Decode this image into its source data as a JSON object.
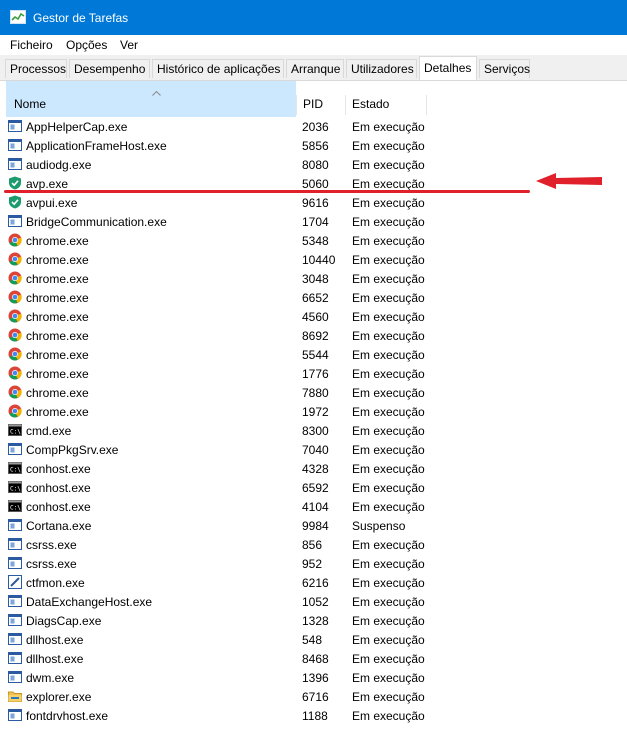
{
  "window": {
    "title": "Gestor de Tarefas"
  },
  "menu": [
    "Ficheiro",
    "Opções",
    "Ver"
  ],
  "tabs": [
    {
      "label": "Processos"
    },
    {
      "label": "Desempenho"
    },
    {
      "label": "Histórico de aplicações"
    },
    {
      "label": "Arranque"
    },
    {
      "label": "Utilizadores"
    },
    {
      "label": "Detalhes",
      "active": true
    },
    {
      "label": "Serviços"
    }
  ],
  "columns": {
    "name": "Nome",
    "pid": "PID",
    "state": "Estado"
  },
  "colors": {
    "accent": "#0078d7",
    "selected_header": "#cce8ff",
    "annotation": "#e0202a"
  },
  "rows": [
    {
      "icon": "window-icon",
      "name": "AppHelperCap.exe",
      "pid": "2036",
      "state": "Em execução"
    },
    {
      "icon": "window-icon",
      "name": "ApplicationFrameHost.exe",
      "pid": "5856",
      "state": "Em execução"
    },
    {
      "icon": "window-icon",
      "name": "audiodg.exe",
      "pid": "8080",
      "state": "Em execução"
    },
    {
      "icon": "shield-icon",
      "name": "avp.exe",
      "pid": "5060",
      "state": "Em execução"
    },
    {
      "icon": "shield-icon",
      "name": "avpui.exe",
      "pid": "9616",
      "state": "Em execução"
    },
    {
      "icon": "window-icon",
      "name": "BridgeCommunication.exe",
      "pid": "1704",
      "state": "Em execução"
    },
    {
      "icon": "chrome-icon",
      "name": "chrome.exe",
      "pid": "5348",
      "state": "Em execução"
    },
    {
      "icon": "chrome-icon",
      "name": "chrome.exe",
      "pid": "10440",
      "state": "Em execução"
    },
    {
      "icon": "chrome-icon",
      "name": "chrome.exe",
      "pid": "3048",
      "state": "Em execução"
    },
    {
      "icon": "chrome-icon",
      "name": "chrome.exe",
      "pid": "6652",
      "state": "Em execução"
    },
    {
      "icon": "chrome-icon",
      "name": "chrome.exe",
      "pid": "4560",
      "state": "Em execução"
    },
    {
      "icon": "chrome-icon",
      "name": "chrome.exe",
      "pid": "8692",
      "state": "Em execução"
    },
    {
      "icon": "chrome-icon",
      "name": "chrome.exe",
      "pid": "5544",
      "state": "Em execução"
    },
    {
      "icon": "chrome-icon",
      "name": "chrome.exe",
      "pid": "1776",
      "state": "Em execução"
    },
    {
      "icon": "chrome-icon",
      "name": "chrome.exe",
      "pid": "7880",
      "state": "Em execução"
    },
    {
      "icon": "chrome-icon",
      "name": "chrome.exe",
      "pid": "1972",
      "state": "Em execução"
    },
    {
      "icon": "console-icon",
      "name": "cmd.exe",
      "pid": "8300",
      "state": "Em execução"
    },
    {
      "icon": "window-icon",
      "name": "CompPkgSrv.exe",
      "pid": "7040",
      "state": "Em execução"
    },
    {
      "icon": "console-icon",
      "name": "conhost.exe",
      "pid": "4328",
      "state": "Em execução"
    },
    {
      "icon": "console-icon",
      "name": "conhost.exe",
      "pid": "6592",
      "state": "Em execução"
    },
    {
      "icon": "console-icon",
      "name": "conhost.exe",
      "pid": "4104",
      "state": "Em execução"
    },
    {
      "icon": "window-icon",
      "name": "Cortana.exe",
      "pid": "9984",
      "state": "Suspenso"
    },
    {
      "icon": "window-icon",
      "name": "csrss.exe",
      "pid": "856",
      "state": "Em execução"
    },
    {
      "icon": "window-icon",
      "name": "csrss.exe",
      "pid": "952",
      "state": "Em execução"
    },
    {
      "icon": "pen-icon",
      "name": "ctfmon.exe",
      "pid": "6216",
      "state": "Em execução"
    },
    {
      "icon": "window-icon",
      "name": "DataExchangeHost.exe",
      "pid": "1052",
      "state": "Em execução"
    },
    {
      "icon": "window-icon",
      "name": "DiagsCap.exe",
      "pid": "1328",
      "state": "Em execução"
    },
    {
      "icon": "window-icon",
      "name": "dllhost.exe",
      "pid": "548",
      "state": "Em execução"
    },
    {
      "icon": "window-icon",
      "name": "dllhost.exe",
      "pid": "8468",
      "state": "Em execução"
    },
    {
      "icon": "window-icon",
      "name": "dwm.exe",
      "pid": "1396",
      "state": "Em execução"
    },
    {
      "icon": "folder-icon",
      "name": "explorer.exe",
      "pid": "6716",
      "state": "Em execução"
    },
    {
      "icon": "window-icon",
      "name": "fontdrvhost.exe",
      "pid": "1188",
      "state": "Em execução"
    }
  ]
}
